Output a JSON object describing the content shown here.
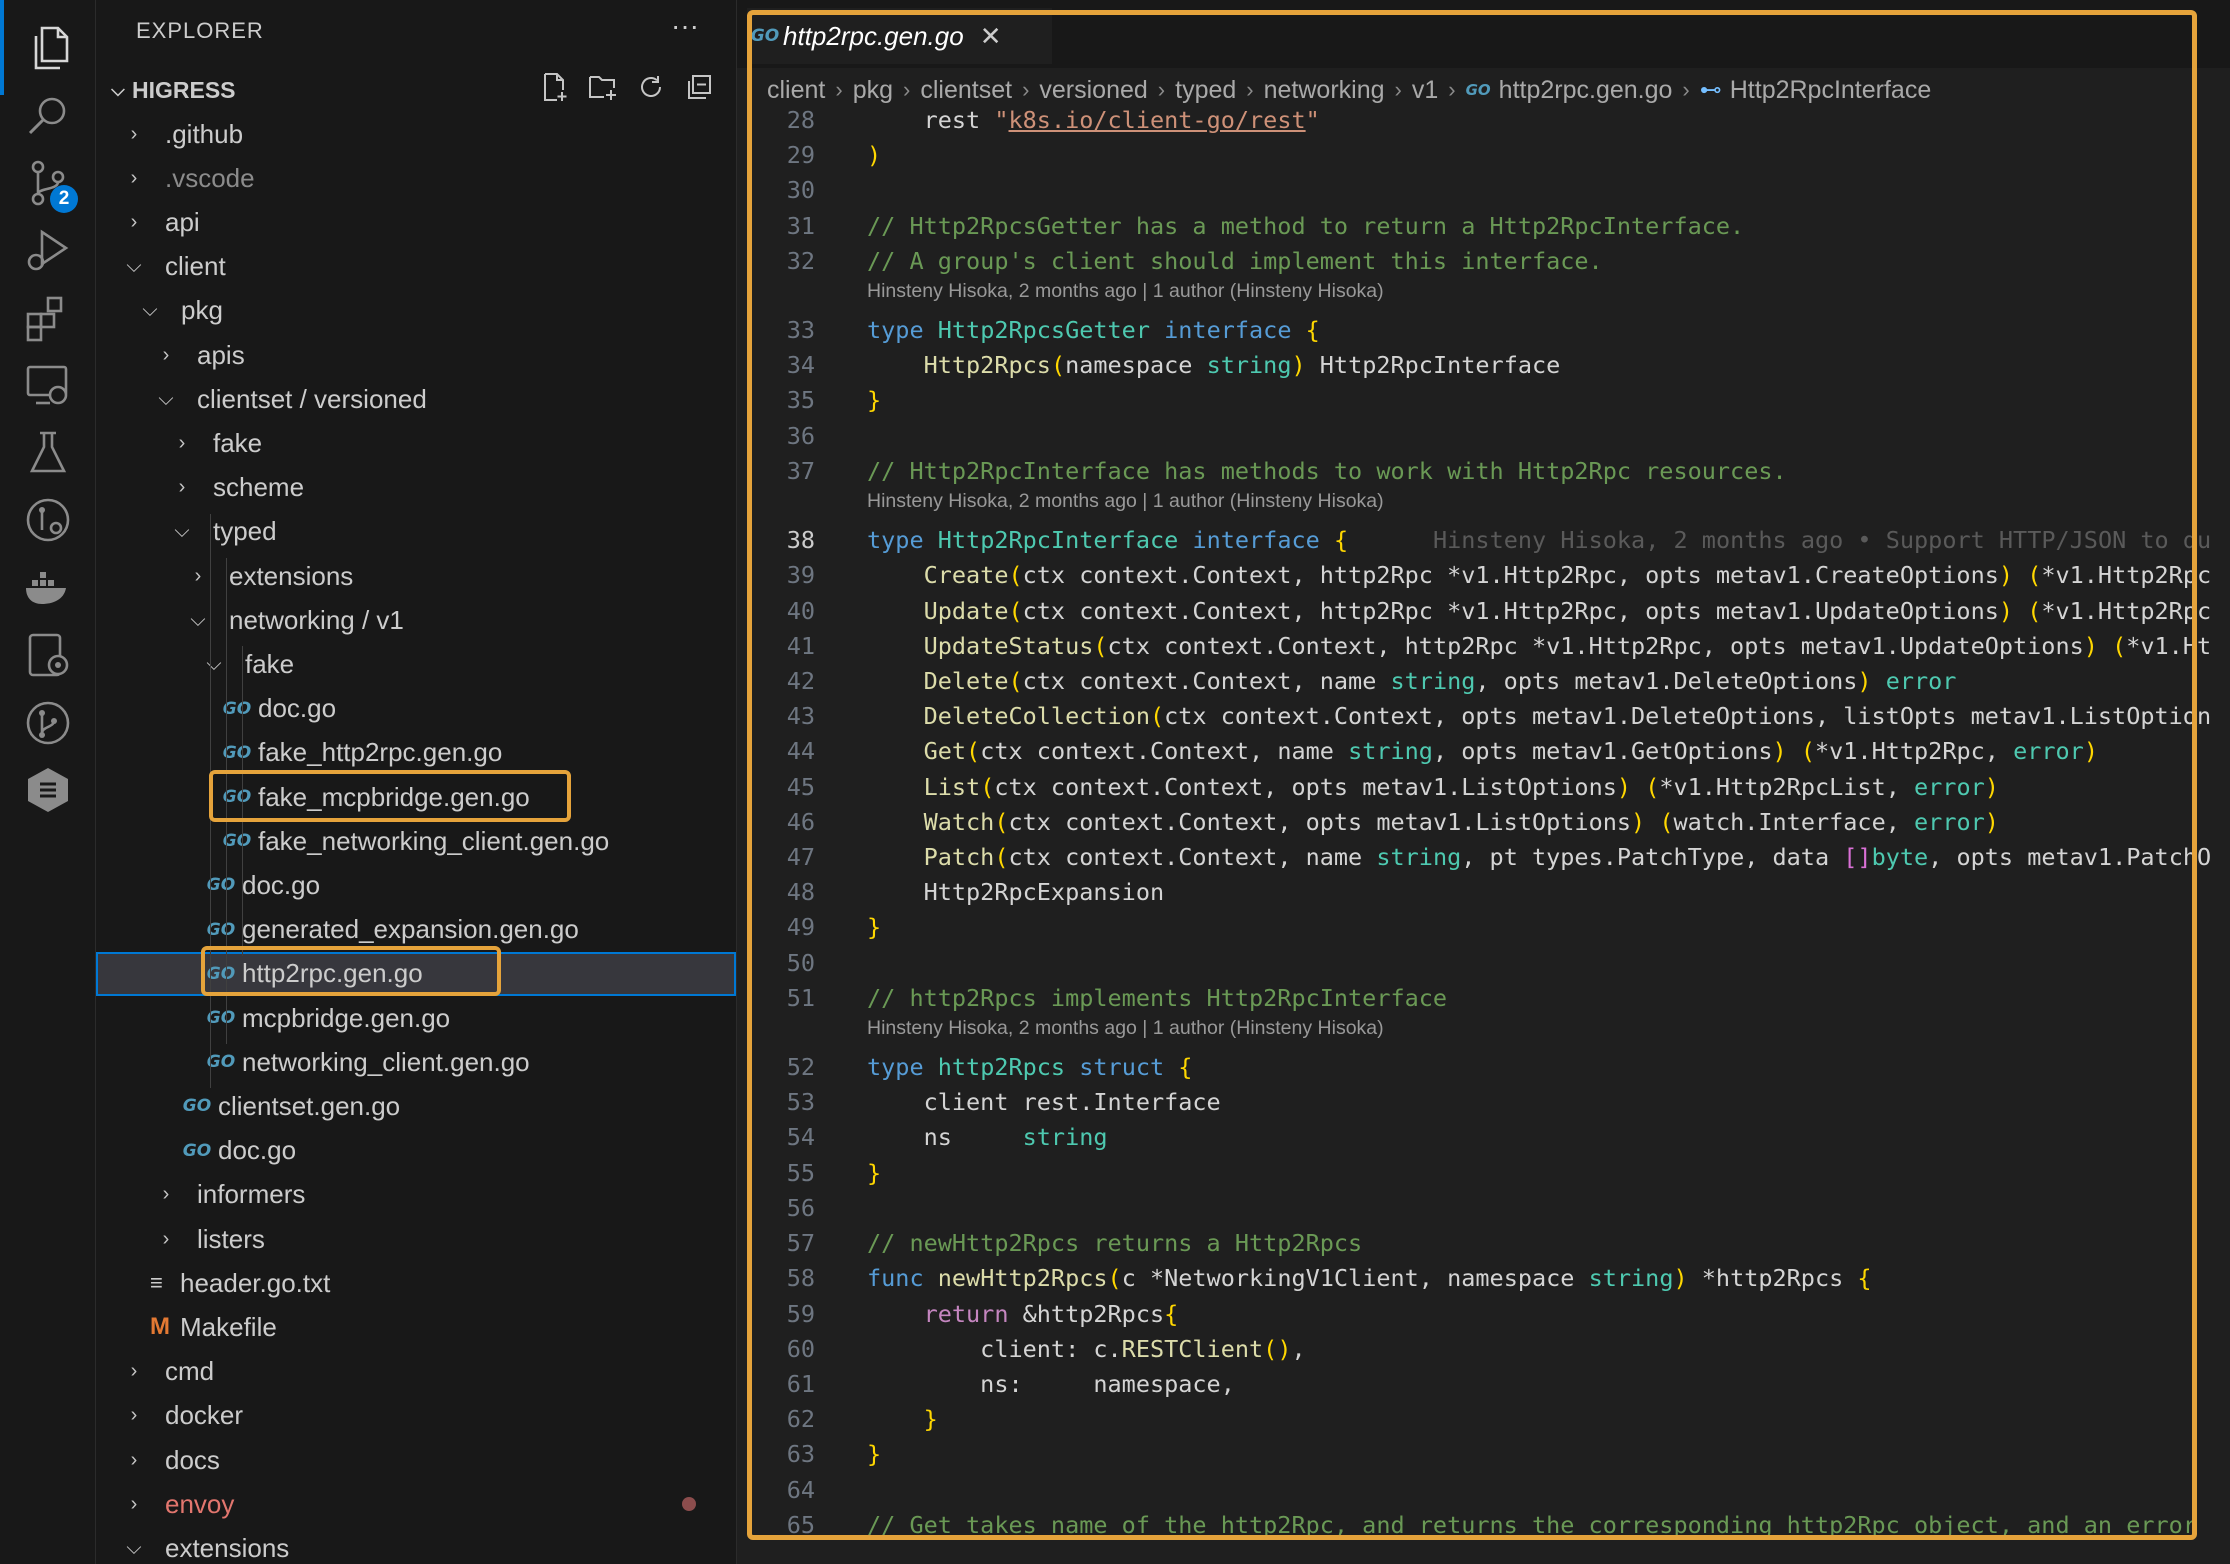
{
  "activity_bar": {
    "items": [
      {
        "icon": "files-icon",
        "active": true
      },
      {
        "icon": "search-icon"
      },
      {
        "icon": "source-control-icon",
        "badge": "2"
      },
      {
        "icon": "run-debug-icon"
      },
      {
        "icon": "extensions-icon"
      },
      {
        "icon": "remote-explorer-icon"
      },
      {
        "icon": "testing-icon"
      },
      {
        "icon": "gitlens-icon"
      },
      {
        "icon": "docker-icon"
      },
      {
        "icon": "kubernetes-icon"
      },
      {
        "icon": "git-graph-icon"
      },
      {
        "icon": "codeium-icon"
      }
    ]
  },
  "sidebar": {
    "title": "EXPLORER",
    "more": "···",
    "root": "HIGRESS",
    "tree": [
      {
        "label": ".github",
        "kind": "folder",
        "open": false
      },
      {
        "label": ".vscode",
        "kind": "folder",
        "open": false,
        "dim": true
      },
      {
        "label": "api",
        "kind": "folder",
        "open": false
      },
      {
        "label": "client",
        "kind": "folder",
        "open": true
      },
      {
        "label": "pkg",
        "kind": "folder",
        "open": true
      },
      {
        "label": "apis",
        "kind": "folder",
        "open": false
      },
      {
        "label": "clientset / versioned",
        "kind": "folder",
        "open": true
      },
      {
        "label": "fake",
        "kind": "folder",
        "open": false
      },
      {
        "label": "scheme",
        "kind": "folder",
        "open": false
      },
      {
        "label": "typed",
        "kind": "folder",
        "open": true
      },
      {
        "label": "extensions",
        "kind": "folder",
        "open": false
      },
      {
        "label": "networking / v1",
        "kind": "folder",
        "open": true
      },
      {
        "label": "fake",
        "kind": "folder",
        "open": true
      },
      {
        "label": "doc.go",
        "kind": "go"
      },
      {
        "label": "fake_http2rpc.gen.go",
        "kind": "go"
      },
      {
        "label": "fake_mcpbridge.gen.go",
        "kind": "go"
      },
      {
        "label": "fake_networking_client.gen.go",
        "kind": "go"
      },
      {
        "label": "doc.go",
        "kind": "go"
      },
      {
        "label": "generated_expansion.gen.go",
        "kind": "go"
      },
      {
        "label": "http2rpc.gen.go",
        "kind": "go",
        "selected": true
      },
      {
        "label": "mcpbridge.gen.go",
        "kind": "go"
      },
      {
        "label": "networking_client.gen.go",
        "kind": "go"
      },
      {
        "label": "clientset.gen.go",
        "kind": "go"
      },
      {
        "label": "doc.go",
        "kind": "go"
      },
      {
        "label": "informers",
        "kind": "folder",
        "open": false
      },
      {
        "label": "listers",
        "kind": "folder",
        "open": false
      },
      {
        "label": "header.go.txt",
        "kind": "text"
      },
      {
        "label": "Makefile",
        "kind": "make"
      },
      {
        "label": "cmd",
        "kind": "folder",
        "open": false
      },
      {
        "label": "docker",
        "kind": "folder",
        "open": false
      },
      {
        "label": "docs",
        "kind": "folder",
        "open": false
      },
      {
        "label": "envoy",
        "kind": "folder",
        "open": false,
        "modified": true
      },
      {
        "label": "extensions",
        "kind": "folder",
        "open": true
      }
    ]
  },
  "editor": {
    "tab": {
      "icon_text": "GO",
      "title": "http2rpc.gen.go",
      "close": "✕"
    },
    "breadcrumbs": [
      "client",
      "pkg",
      "clientset",
      "versioned",
      "typed",
      "networking",
      "v1",
      "http2rpc.gen.go",
      "Http2RpcInterface"
    ],
    "blame": {
      "codelens": "Hinsteny Hisoka, 2 months ago | 1 author (Hinsteny Hisoka)",
      "inline": "Hinsteny Hisoka, 2 months ago • Support HTTP/JSON to du"
    },
    "lines": [
      {
        "n": "28",
        "code": "    rest \"k8s.io/client-go/rest\""
      },
      {
        "n": "29",
        "code": ")"
      },
      {
        "n": "30",
        "code": ""
      },
      {
        "n": "31",
        "code": "// Http2RpcsGetter has a method to return a Http2RpcInterface."
      },
      {
        "n": "32",
        "code": "// A group's client should implement this interface."
      },
      {
        "n": "33",
        "code": "type Http2RpcsGetter interface {"
      },
      {
        "n": "34",
        "code": "    Http2Rpcs(namespace string) Http2RpcInterface"
      },
      {
        "n": "35",
        "code": "}"
      },
      {
        "n": "36",
        "code": ""
      },
      {
        "n": "37",
        "code": "// Http2RpcInterface has methods to work with Http2Rpc resources."
      },
      {
        "n": "38",
        "code": "type Http2RpcInterface interface {"
      },
      {
        "n": "39",
        "code": "    Create(ctx context.Context, http2Rpc *v1.Http2Rpc, opts metav1.CreateOptions) (*v1.Http2Rpc"
      },
      {
        "n": "40",
        "code": "    Update(ctx context.Context, http2Rpc *v1.Http2Rpc, opts metav1.UpdateOptions) (*v1.Http2Rpc"
      },
      {
        "n": "41",
        "code": "    UpdateStatus(ctx context.Context, http2Rpc *v1.Http2Rpc, opts metav1.UpdateOptions) (*v1.Ht"
      },
      {
        "n": "42",
        "code": "    Delete(ctx context.Context, name string, opts metav1.DeleteOptions) error"
      },
      {
        "n": "43",
        "code": "    DeleteCollection(ctx context.Context, opts metav1.DeleteOptions, listOpts metav1.ListOption"
      },
      {
        "n": "44",
        "code": "    Get(ctx context.Context, name string, opts metav1.GetOptions) (*v1.Http2Rpc, error)"
      },
      {
        "n": "45",
        "code": "    List(ctx context.Context, opts metav1.ListOptions) (*v1.Http2RpcList, error)"
      },
      {
        "n": "46",
        "code": "    Watch(ctx context.Context, opts metav1.ListOptions) (watch.Interface, error)"
      },
      {
        "n": "47",
        "code": "    Patch(ctx context.Context, name string, pt types.PatchType, data []byte, opts metav1.PatchO"
      },
      {
        "n": "48",
        "code": "    Http2RpcExpansion"
      },
      {
        "n": "49",
        "code": "}"
      },
      {
        "n": "50",
        "code": ""
      },
      {
        "n": "51",
        "code": "// http2Rpcs implements Http2RpcInterface"
      },
      {
        "n": "52",
        "code": "type http2Rpcs struct {"
      },
      {
        "n": "53",
        "code": "    client rest.Interface"
      },
      {
        "n": "54",
        "code": "    ns     string"
      },
      {
        "n": "55",
        "code": "}"
      },
      {
        "n": "56",
        "code": ""
      },
      {
        "n": "57",
        "code": "// newHttp2Rpcs returns a Http2Rpcs"
      },
      {
        "n": "58",
        "code": "func newHttp2Rpcs(c *NetworkingV1Client, namespace string) *http2Rpcs {"
      },
      {
        "n": "59",
        "code": "    return &http2Rpcs{"
      },
      {
        "n": "60",
        "code": "        client: c.RESTClient(),"
      },
      {
        "n": "61",
        "code": "        ns:     namespace,"
      },
      {
        "n": "62",
        "code": "    }"
      },
      {
        "n": "63",
        "code": "}"
      },
      {
        "n": "64",
        "code": ""
      },
      {
        "n": "65",
        "code": "// Get takes name of the http2Rpc, and returns the corresponding http2Rpc object, and an error"
      }
    ]
  }
}
